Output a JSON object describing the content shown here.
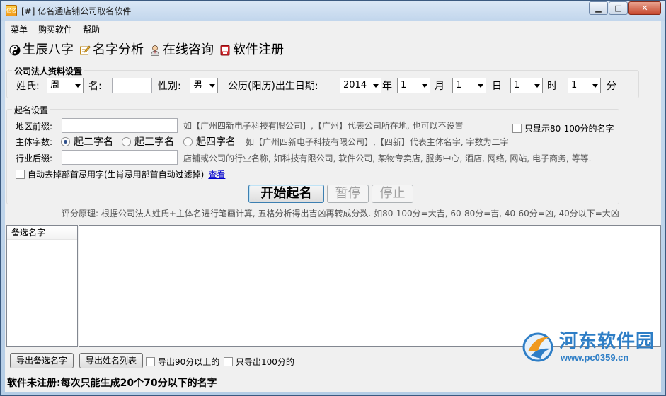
{
  "window": {
    "title": "[#] 亿名通店铺公司取名软件",
    "icon_text": "亿名",
    "controls": {
      "minimize": "▁",
      "maximize": "□",
      "close": "✕"
    }
  },
  "menu": [
    "菜单",
    "购买软件",
    "帮助"
  ],
  "toolbar": [
    {
      "label": "生辰八字",
      "icon": "yin-yang-icon"
    },
    {
      "label": "名字分析",
      "icon": "edit-icon"
    },
    {
      "label": "在线咨询",
      "icon": "person-icon"
    },
    {
      "label": "软件注册",
      "icon": "register-icon"
    }
  ],
  "person_group": {
    "title": "公司法人资料设置",
    "surname_label": "姓氏:",
    "surname_value": "周",
    "name_label": "名:",
    "name_value": "",
    "gender_label": "性别:",
    "gender_value": "男",
    "birth_label": "公历(阳历)出生日期:",
    "year_value": "2014",
    "year_unit": "年",
    "month_value": "1",
    "month_unit": "月",
    "day_value": "1",
    "day_unit": "日",
    "hour_value": "1",
    "hour_unit": "时",
    "minute_value": "1",
    "minute_unit": "分"
  },
  "naming_group": {
    "title": "起名设置",
    "region_label": "地区前缀:",
    "region_value": "",
    "region_hint": "如【广州四新电子科技有限公司】,【广州】代表公司所在地, 也可以不设置",
    "only_high_score": "只显示80-100分的名字",
    "chars_label": "主体字数:",
    "radio_options": [
      "起二字名",
      "起三字名",
      "起四字名"
    ],
    "selected_radio": 0,
    "chars_hint": "如【广州四新电子科技有限公司】,【四新】代表主体名字, 字数为二字",
    "industry_label": "行业后缀:",
    "industry_value": "",
    "industry_hint": "店铺或公司的行业名称, 如科技有限公司, 软件公司, 某物专卖店, 服务中心, 酒店, 网络, 网站, 电子商务, 等等.",
    "auto_filter": "自动去掉部首忌用字(生肖忌用部首自动过滤掉)",
    "view_link": "查看",
    "start_button": "开始起名",
    "pause_button": "暂停",
    "stop_button": "停止"
  },
  "score_note": "评分原理: 根据公司法人姓氏+主体名进行笔画计算, 五格分析得出吉凶再转成分数. 如80-100分=大吉, 60-80分=吉, 40-60分=凶, 40分以下=大凶",
  "candidates": {
    "header": "备选名字",
    "items": []
  },
  "bottom": {
    "export_candidates": "导出备选名字",
    "export_names": "导出姓名列表",
    "export_90": "导出90分以上的",
    "export_100": "只导出100分的"
  },
  "status": "软件未注册:每次只能生成20个70分以下的名字",
  "watermark": {
    "name": "河东软件园",
    "url": "www.pc0359.cn"
  }
}
